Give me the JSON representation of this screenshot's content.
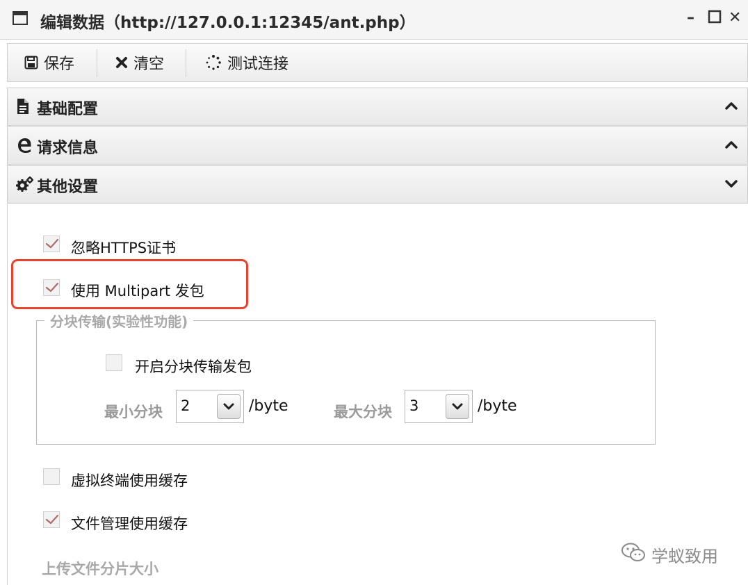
{
  "window": {
    "title": "编辑数据（http://127.0.0.1:12345/ant.php）"
  },
  "toolbar": {
    "save_label": "保存",
    "clear_label": "清空",
    "test_label": "测试连接"
  },
  "sections": {
    "basic": "基础配置",
    "request": "请求信息",
    "other": "其他设置"
  },
  "options": {
    "ignore_https": {
      "label": "忽略HTTPS证书",
      "checked": true
    },
    "multipart": {
      "label": "使用 Multipart 发包",
      "checked": true
    },
    "chunked": {
      "legend": "分块传输(实验性功能)",
      "enable": {
        "label": "开启分块传输发包",
        "checked": false
      },
      "min_label": "最小分块",
      "min_value": "2",
      "max_label": "最大分块",
      "max_value": "3",
      "unit": "/byte"
    },
    "terminal_cache": {
      "label": "虚拟终端使用缓存",
      "checked": false
    },
    "file_cache": {
      "label": "文件管理使用缓存",
      "checked": true
    },
    "upload_chunk_label": "上传文件分片大小"
  },
  "watermark": {
    "text": "学蚁致用"
  },
  "colors": {
    "highlight": "#e8432c",
    "check": "#b06a6a"
  }
}
